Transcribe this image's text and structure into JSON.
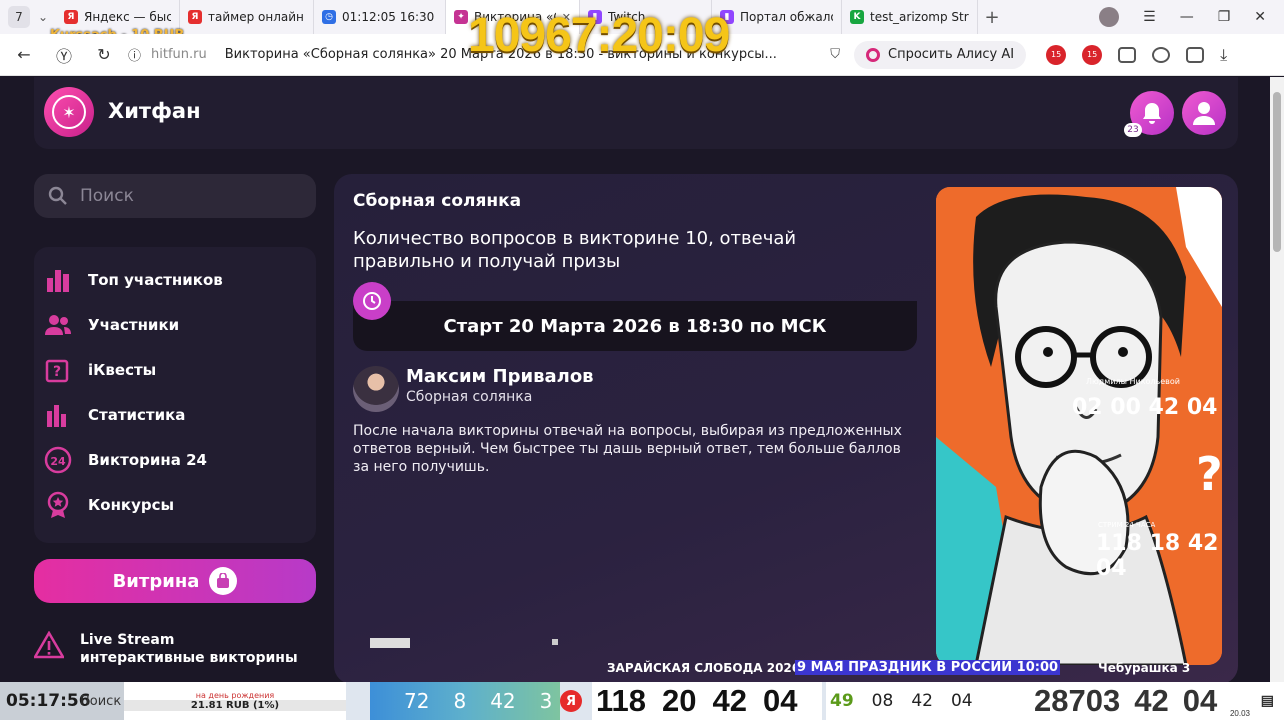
{
  "browser": {
    "tab_count": "7",
    "tabs": [
      {
        "title": "Яндекс — быстр",
        "color": "#e52f2f",
        "glyph": "Я"
      },
      {
        "title": "таймер онлайн",
        "color": "#e52f2f",
        "glyph": "Я"
      },
      {
        "title": "01:12:05 16:30",
        "color": "#2f6fe5",
        "glyph": "◷"
      },
      {
        "title": "Викторина «Сб",
        "color": "#c53393",
        "glyph": "✦"
      },
      {
        "title": "Twitch",
        "color": "#9146ff",
        "glyph": "▮"
      },
      {
        "title": "Портал обжало",
        "color": "#9146ff",
        "glyph": "▮"
      },
      {
        "title": "test_arizomp Str",
        "color": "#18a640",
        "glyph": "K"
      }
    ],
    "domain": "hitfun.ru",
    "page_title": "Викторина «Сборная солянка» 20 Марта 2026 в 18:30 - викторины и конкурсы...",
    "alisa_label": "Спросить Алису AI",
    "ext_badge_1": "15",
    "ext_badge_2": "15"
  },
  "overlay": {
    "kurssach": "Kurssach - 10 RUB",
    "big_timer": "10967:20:09"
  },
  "site": {
    "brand": "Хитфан",
    "notifications_count": "23",
    "search_placeholder": "Поиск",
    "menu": [
      {
        "label": "Топ участников",
        "icon": "bar-chart-icon"
      },
      {
        "label": "Участники",
        "icon": "users-icon"
      },
      {
        "label": "iКвесты",
        "icon": "question-icon"
      },
      {
        "label": "Статистика",
        "icon": "stats-icon"
      },
      {
        "label": "Викторина 24",
        "icon": "clock24-icon"
      },
      {
        "label": "Конкурсы",
        "icon": "medal-icon"
      }
    ],
    "vitrina_label": "Витрина",
    "live_title": "Live Stream",
    "live_sub": "интерактивные викторины"
  },
  "quiz": {
    "category": "Сборная солянка",
    "description": "Количество вопросов в викторине 10, отвечай правильно и получай призы",
    "start": "Старт 20 Марта 2026 в 18:30 по МСК",
    "author_name": "Максим Привалов",
    "author_sub": "Сборная солянка",
    "rules": "После начала викторины отвечай на вопросы, выбирая из предложенных ответов верный. Чем быстрее ты дашь верный ответ, тем больше баллов за него получишь."
  },
  "poster": {
    "label": "Людмилы Никольевой",
    "timer_top": "02 00 42 04",
    "caption": "СТРИМ 24 ЧАСА",
    "timer_bottom": "118 18 42 04",
    "qmark": "?"
  },
  "ticker": {
    "left": "ЗАРАЙСКАЯ СЛОБОДА 2026",
    "middle": "9 МАЯ ПРАЗДНИК В РОССИИ 10:00",
    "right": "Чебурашка 3"
  },
  "taskbar": {
    "time": "05:17:56",
    "search": "Поиск",
    "rub_top": "на день рождения",
    "rub_main": "21.81 RUB (1%)",
    "weather": [
      "72",
      "8",
      "42",
      "3"
    ],
    "big1": [
      "118",
      "20",
      "42",
      "04"
    ],
    "mid": [
      "49",
      "08",
      "42",
      "04"
    ],
    "big2": [
      "28703",
      "42",
      "04"
    ],
    "date": "20.03"
  }
}
